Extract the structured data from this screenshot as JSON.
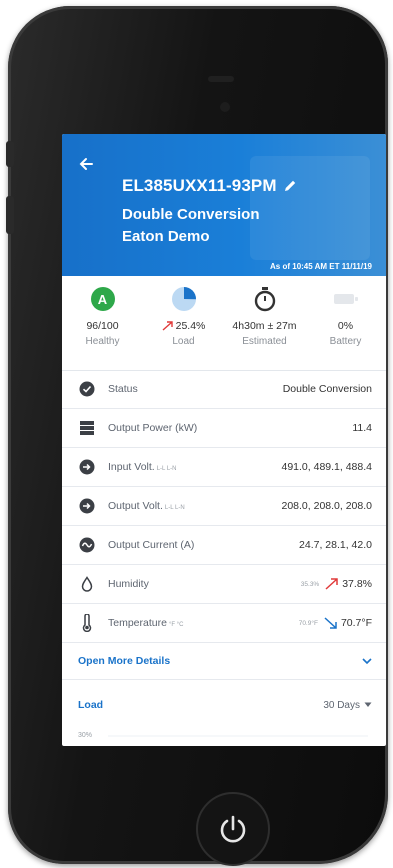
{
  "header": {
    "device_name": "EL385UXX11-93PM",
    "mode": "Double Conversion",
    "site": "Eaton Demo",
    "as_of": "As of 10:45 AM ET 11/11/19"
  },
  "kpis": {
    "health": {
      "badge": "A",
      "value": "96/100",
      "label": "Healthy"
    },
    "load": {
      "value": "25.4%",
      "label": "Load",
      "fraction": 0.254
    },
    "estimated": {
      "value": "4h30m ± 27m",
      "label": "Estimated"
    },
    "battery": {
      "value": "0%",
      "label": "Battery",
      "fraction": 0
    }
  },
  "rows": [
    {
      "label": "Status",
      "value": "Double Conversion",
      "icon": "check-circle-icon"
    },
    {
      "label": "Output Power (kW)",
      "value": "11.4",
      "icon": "power-stack-icon"
    },
    {
      "label": "Input Volt.",
      "legend": "L-L L-N",
      "value": "491.0, 489.1, 488.4",
      "icon": "input-plug-icon"
    },
    {
      "label": "Output Volt.",
      "legend": "L-L L-N",
      "value": "208.0, 208.0, 208.0",
      "icon": "output-plug-icon"
    },
    {
      "label": "Output Current (A)",
      "value": "24.7, 28.1, 42.0",
      "icon": "wave-icon"
    },
    {
      "label": "Humidity",
      "prev": "35.3%",
      "value": "37.8%",
      "icon": "droplet-icon"
    },
    {
      "label": "Temperature",
      "legend": "°F °C",
      "prev": "70.9°F",
      "value": "70.7°F",
      "icon": "thermometer-icon"
    }
  ],
  "more_details": "Open More Details",
  "load_section": {
    "title": "Load",
    "range": "30 Days",
    "y_top_tick": "30%"
  },
  "colors": {
    "header": "#1a7fd8",
    "accent": "#1a73c9",
    "healthy": "#2ea84a",
    "trend_up": "#e03a3a",
    "trend_down": "#1a73c9"
  }
}
